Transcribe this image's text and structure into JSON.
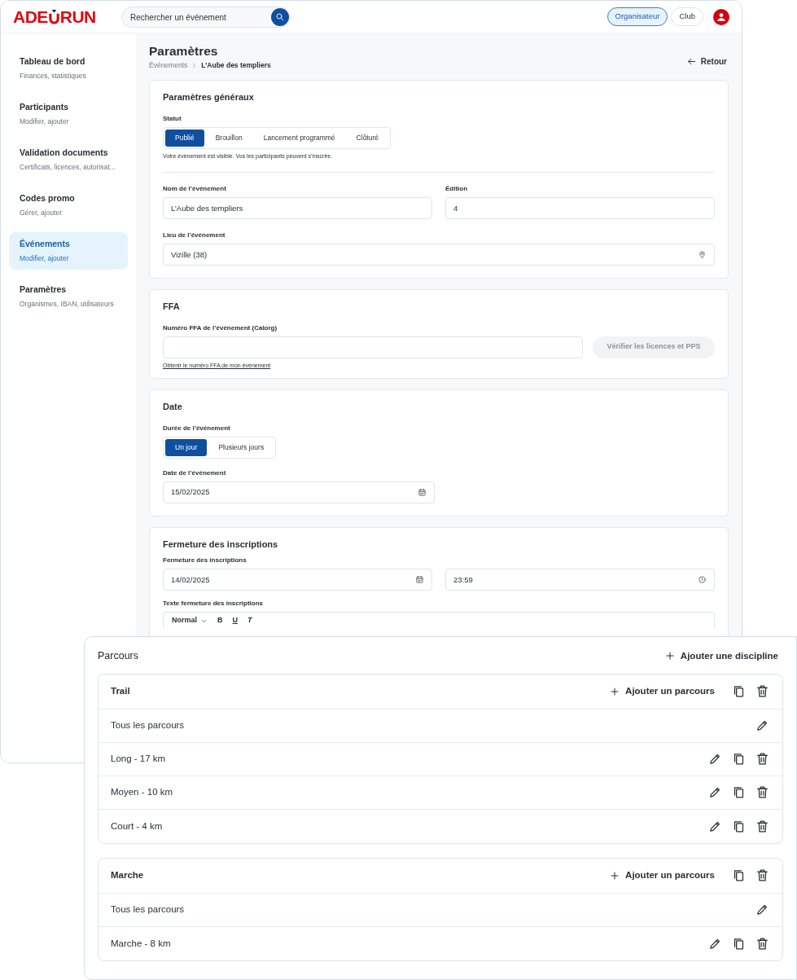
{
  "header": {
    "logo": {
      "left": "ADE",
      "right": "RUN"
    },
    "search": {
      "placeholder": "Rechercher un événement"
    },
    "roles": [
      {
        "label": "Organisateur",
        "selected": true
      },
      {
        "label": "Club",
        "selected": false
      }
    ]
  },
  "sidebar": {
    "items": [
      {
        "title": "Tableau de bord",
        "subtitle": "Finances, statistiques",
        "selected": false
      },
      {
        "title": "Participants",
        "subtitle": "Modifier, ajouter",
        "selected": false
      },
      {
        "title": "Validation documents",
        "subtitle": "Certificats, licences, autorisat...",
        "selected": false
      },
      {
        "title": "Codes promo",
        "subtitle": "Gérer, ajouter",
        "selected": false
      },
      {
        "title": "Événements",
        "subtitle": "Modifier, ajouter",
        "selected": true
      },
      {
        "title": "Paramètres",
        "subtitle": "Organismes, IBAN, utilisateurs",
        "selected": false
      }
    ]
  },
  "page": {
    "title": "Paramètres",
    "breadcrumb": [
      "Événements",
      "L’Aube des templiers"
    ],
    "back": "Retour"
  },
  "general": {
    "title": "Paramètres généraux",
    "status_label": "Statut",
    "status_options": [
      {
        "label": "Publié",
        "selected": true
      },
      {
        "label": "Brouillon",
        "selected": false
      },
      {
        "label": "Lancement programmé",
        "selected": false
      },
      {
        "label": "Clôturé",
        "selected": false
      }
    ],
    "status_help": "Votre événement est visible. Vos les participants peuvent s’inscrire.",
    "name_label": "Nom de l’événement",
    "name_value": "L’Aube des templiers",
    "edition_label": "Édition",
    "edition_value": "4",
    "place_label": "Lieu de l’événement",
    "place_value": "Vizille (38)"
  },
  "ffa": {
    "title": "FFA",
    "label": "Numéro FFA de l’événement (Calorg)",
    "button": {
      "label": "Vérifier les licences et PPS",
      "disabled": true
    },
    "link": "Obtenir le numéro FFA de mon événement"
  },
  "date": {
    "title": "Date",
    "duration_label": "Durée de l’événement",
    "duration_options": [
      {
        "label": "Un jour",
        "selected": true
      },
      {
        "label": "Plusieurs jours",
        "selected": false
      }
    ],
    "date_label": "Date de l’événement",
    "date_value": "15/02/2025"
  },
  "closing": {
    "title": "Fermeture des inscriptions",
    "label": "Fermeture des inscriptions",
    "date_value": "14/02/2025",
    "time_value": "23:59",
    "text_label": "Texte fermeture des inscriptions",
    "toolbar": [
      "Normal",
      "B",
      "U",
      "T"
    ]
  },
  "parcours": {
    "title": "Parcours",
    "add_discipline": "Ajouter une discipline",
    "groups": [
      {
        "name": "Trail",
        "add": "Ajouter un parcours",
        "rows": [
          {
            "label": "Tous les parcours",
            "kind": "all"
          },
          {
            "label": "Long - 17 km",
            "kind": "course"
          },
          {
            "label": "Moyen - 10 km",
            "kind": "course"
          },
          {
            "label": "Court - 4 km",
            "kind": "course"
          }
        ]
      },
      {
        "name": "Marche",
        "add": "Ajouter un parcours",
        "rows": [
          {
            "label": "Tous les parcours",
            "kind": "all"
          },
          {
            "label": "Marche - 8 km",
            "kind": "course"
          }
        ]
      }
    ]
  }
}
